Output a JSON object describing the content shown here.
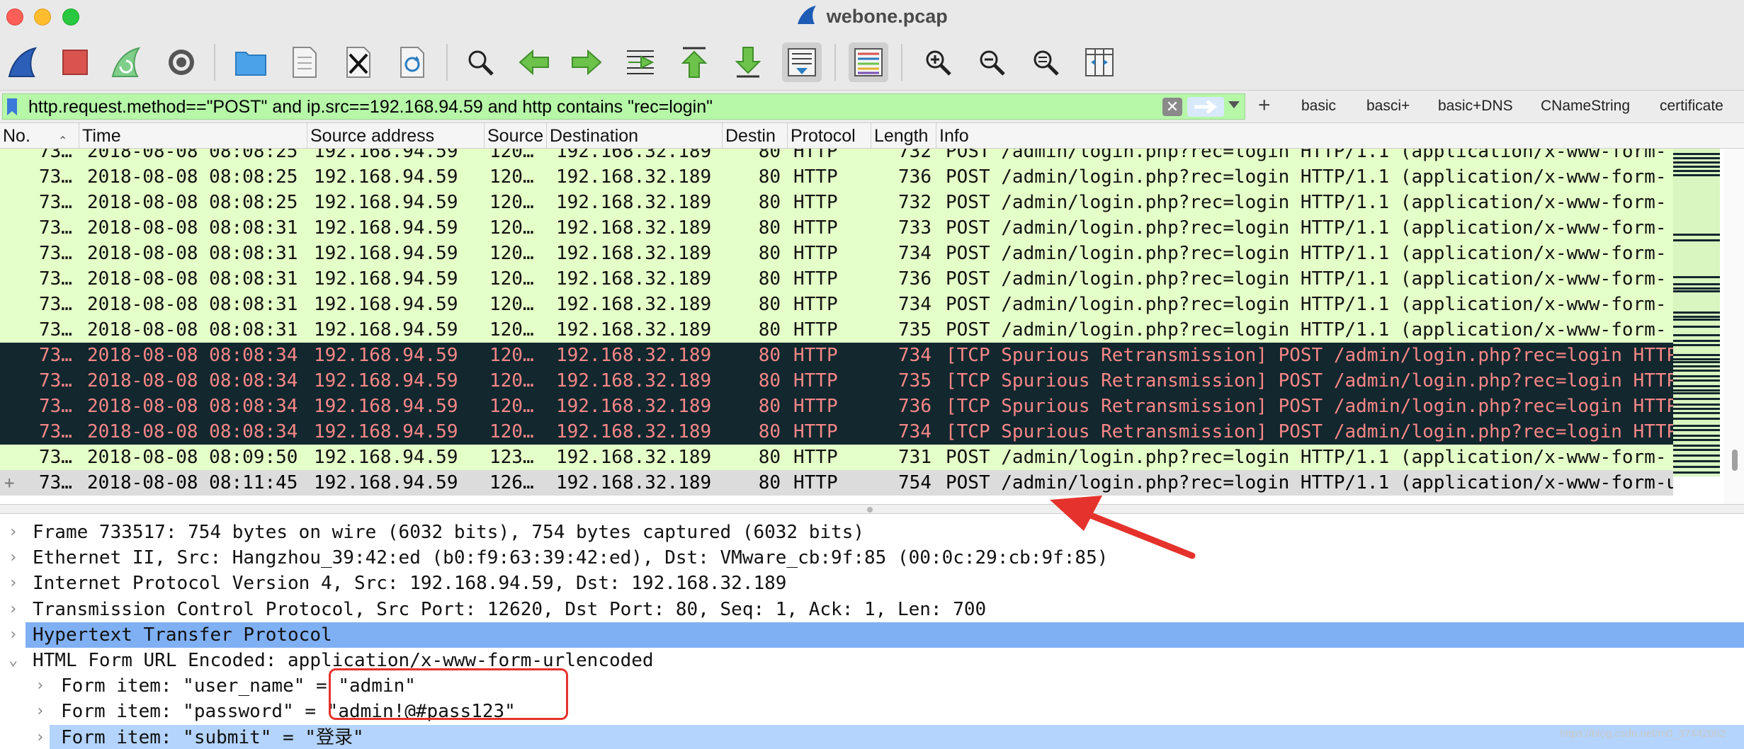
{
  "window": {
    "title": "webone.pcap"
  },
  "toolbar": {
    "buttons": [
      "shark-fin-start-icon",
      "stop-capture-icon",
      "restart-capture-icon",
      "capture-options-icon",
      "open-file-icon",
      "save-file-icon",
      "close-file-icon",
      "reload-file-icon",
      "find-packet-icon",
      "go-back-icon",
      "go-forward-icon",
      "go-to-packet-icon",
      "go-first-packet-icon",
      "go-last-packet-icon",
      "autoscroll-icon",
      "colorize-icon",
      "zoom-in-icon",
      "zoom-out-icon",
      "normal-size-icon",
      "resize-columns-icon"
    ]
  },
  "filter": {
    "expression": "http.request.method==\"POST\" and ip.src==192.168.94.59 and http contains \"rec=login\"",
    "clear_glyph": "✕",
    "add_button": "+",
    "buttons": [
      "basic",
      "basci+",
      "basic+DNS",
      "CNameString",
      "certificate"
    ]
  },
  "columns": {
    "no": "No.",
    "time": "Time",
    "source": "Source address",
    "source2": "Source",
    "destination": "Destination",
    "dest_port": "Destin",
    "protocol": "Protocol",
    "length": "Length",
    "info": "Info"
  },
  "packets": [
    {
      "no": "73…",
      "time": "2018-08-08 08:08:25",
      "src": "192.168.94.59",
      "src2": "120…",
      "dst": "192.168.32.189",
      "dport": "80",
      "proto": "HTTP",
      "len": "732",
      "info": "POST /admin/login.php?rec=login HTTP/1.1  (application/x-www-form-",
      "style": "green"
    },
    {
      "no": "73…",
      "time": "2018-08-08 08:08:25",
      "src": "192.168.94.59",
      "src2": "120…",
      "dst": "192.168.32.189",
      "dport": "80",
      "proto": "HTTP",
      "len": "736",
      "info": "POST /admin/login.php?rec=login HTTP/1.1  (application/x-www-form-",
      "style": "green"
    },
    {
      "no": "73…",
      "time": "2018-08-08 08:08:25",
      "src": "192.168.94.59",
      "src2": "120…",
      "dst": "192.168.32.189",
      "dport": "80",
      "proto": "HTTP",
      "len": "732",
      "info": "POST /admin/login.php?rec=login HTTP/1.1  (application/x-www-form-",
      "style": "green"
    },
    {
      "no": "73…",
      "time": "2018-08-08 08:08:31",
      "src": "192.168.94.59",
      "src2": "120…",
      "dst": "192.168.32.189",
      "dport": "80",
      "proto": "HTTP",
      "len": "733",
      "info": "POST /admin/login.php?rec=login HTTP/1.1  (application/x-www-form-",
      "style": "green"
    },
    {
      "no": "73…",
      "time": "2018-08-08 08:08:31",
      "src": "192.168.94.59",
      "src2": "120…",
      "dst": "192.168.32.189",
      "dport": "80",
      "proto": "HTTP",
      "len": "734",
      "info": "POST /admin/login.php?rec=login HTTP/1.1  (application/x-www-form-",
      "style": "green"
    },
    {
      "no": "73…",
      "time": "2018-08-08 08:08:31",
      "src": "192.168.94.59",
      "src2": "120…",
      "dst": "192.168.32.189",
      "dport": "80",
      "proto": "HTTP",
      "len": "736",
      "info": "POST /admin/login.php?rec=login HTTP/1.1  (application/x-www-form-",
      "style": "green"
    },
    {
      "no": "73…",
      "time": "2018-08-08 08:08:31",
      "src": "192.168.94.59",
      "src2": "120…",
      "dst": "192.168.32.189",
      "dport": "80",
      "proto": "HTTP",
      "len": "734",
      "info": "POST /admin/login.php?rec=login HTTP/1.1  (application/x-www-form-",
      "style": "green"
    },
    {
      "no": "73…",
      "time": "2018-08-08 08:08:31",
      "src": "192.168.94.59",
      "src2": "120…",
      "dst": "192.168.32.189",
      "dport": "80",
      "proto": "HTTP",
      "len": "735",
      "info": "POST /admin/login.php?rec=login HTTP/1.1  (application/x-www-form-",
      "style": "green"
    },
    {
      "no": "73…",
      "time": "2018-08-08 08:08:34",
      "src": "192.168.94.59",
      "src2": "120…",
      "dst": "192.168.32.189",
      "dport": "80",
      "proto": "HTTP",
      "len": "734",
      "info": "[TCP Spurious Retransmission] POST /admin/login.php?rec=login HTTP",
      "style": "dark"
    },
    {
      "no": "73…",
      "time": "2018-08-08 08:08:34",
      "src": "192.168.94.59",
      "src2": "120…",
      "dst": "192.168.32.189",
      "dport": "80",
      "proto": "HTTP",
      "len": "735",
      "info": "[TCP Spurious Retransmission] POST /admin/login.php?rec=login HTTP",
      "style": "dark"
    },
    {
      "no": "73…",
      "time": "2018-08-08 08:08:34",
      "src": "192.168.94.59",
      "src2": "120…",
      "dst": "192.168.32.189",
      "dport": "80",
      "proto": "HTTP",
      "len": "736",
      "info": "[TCP Spurious Retransmission] POST /admin/login.php?rec=login HTTP",
      "style": "dark"
    },
    {
      "no": "73…",
      "time": "2018-08-08 08:08:34",
      "src": "192.168.94.59",
      "src2": "120…",
      "dst": "192.168.32.189",
      "dport": "80",
      "proto": "HTTP",
      "len": "734",
      "info": "[TCP Spurious Retransmission] POST /admin/login.php?rec=login HTTP",
      "style": "dark"
    },
    {
      "no": "73…",
      "time": "2018-08-08 08:09:50",
      "src": "192.168.94.59",
      "src2": "123…",
      "dst": "192.168.32.189",
      "dport": "80",
      "proto": "HTTP",
      "len": "731",
      "info": "POST /admin/login.php?rec=login HTTP/1.1  (application/x-www-form-",
      "style": "green"
    },
    {
      "no": "73…",
      "time": "2018-08-08 08:11:45",
      "src": "192.168.94.59",
      "src2": "126…",
      "dst": "192.168.32.189",
      "dport": "80",
      "proto": "HTTP",
      "len": "754",
      "info": "POST /admin/login.php?rec=login HTTP/1.1  (application/x-www-form-urlenc",
      "style": "sel"
    }
  ],
  "details": [
    {
      "text": "Frame 733517: 754 bytes on wire (6032 bits), 754 bytes captured (6032 bits)",
      "chevron": "›",
      "indent": 0,
      "style": ""
    },
    {
      "text": "Ethernet II, Src: Hangzhou_39:42:ed (b0:f9:63:39:42:ed), Dst: VMware_cb:9f:85 (00:0c:29:cb:9f:85)",
      "chevron": "›",
      "indent": 0,
      "style": ""
    },
    {
      "text": "Internet Protocol Version 4, Src: 192.168.94.59, Dst: 192.168.32.189",
      "chevron": "›",
      "indent": 0,
      "style": ""
    },
    {
      "text": "Transmission Control Protocol, Src Port: 12620, Dst Port: 80, Seq: 1, Ack: 1, Len: 700",
      "chevron": "›",
      "indent": 0,
      "style": ""
    },
    {
      "text": "Hypertext Transfer Protocol",
      "chevron": "›",
      "indent": 0,
      "style": "hl"
    },
    {
      "text": "HTML Form URL Encoded: application/x-www-form-urlencoded",
      "chevron": "⌄",
      "indent": 0,
      "style": ""
    },
    {
      "text": "Form item: \"user_name\" = \"admin\"",
      "chevron": "›",
      "indent": 1,
      "style": ""
    },
    {
      "text": "Form item: \"password\" = \"admin!@#pass123\"",
      "chevron": "›",
      "indent": 1,
      "style": ""
    },
    {
      "text": "Form item: \"submit\" = \"登录\"",
      "chevron": "›",
      "indent": 1,
      "style": "hl2"
    }
  ],
  "watermark": "https://blog.csdn.net/m0_37442062",
  "colors": {
    "filter_valid": "#b6f7a8",
    "row_green": "#e4ffc7",
    "row_dark": "#12272e",
    "row_dark_text": "#f78787",
    "detail_highlight": "#80b0f4",
    "annotation_red": "#e5322c"
  }
}
